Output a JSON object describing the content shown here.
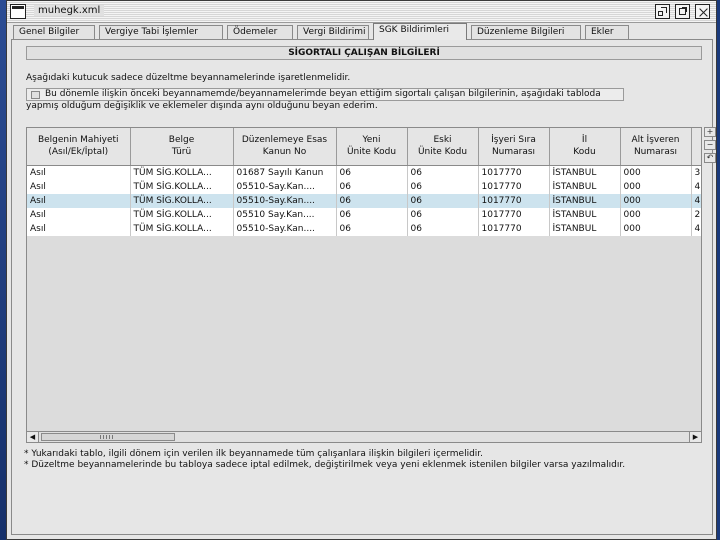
{
  "window": {
    "title": "muhegk.xml"
  },
  "tabs": [
    {
      "label": "Genel Bilgiler"
    },
    {
      "label": "Vergiye Tabi İşlemler"
    },
    {
      "label": "Ödemeler"
    },
    {
      "label": "Vergi Bildirimi"
    },
    {
      "label": "SGK Bildirimleri",
      "active": true
    },
    {
      "label": "Düzenleme Bilgileri"
    },
    {
      "label": "Ekler"
    }
  ],
  "section": {
    "title": "SİGORTALI ÇALIŞAN BİLGİLERİ",
    "instruction": "Aşağıdaki kutucuk sadece düzeltme beyannamelerinde işaretlenmelidir.",
    "checkbox_line1": "Bu dönemle ilişkin önceki beyannamemde/beyannamelerimde beyan ettiğim sigortalı çalışan bilgilerinin, aşağıdaki tabloda",
    "checkbox_line2": "yapmış olduğum değişiklik ve eklemeler dışında aynı olduğunu beyan ederim.",
    "checkbox_checked": false
  },
  "table": {
    "columns": [
      [
        "Belgenin Mahiyeti",
        "(Asıl/Ek/İptal)"
      ],
      [
        "Belge",
        "Türü"
      ],
      [
        "Düzenlemeye Esas",
        "Kanun No"
      ],
      [
        "Yeni",
        "Ünite Kodu"
      ],
      [
        "Eski",
        "Ünite Kodu"
      ],
      [
        "İşyeri Sıra",
        "Numarası"
      ],
      [
        "İl",
        "Kodu"
      ],
      [
        "Alt İşveren",
        "Numarası"
      ],
      [
        "",
        ""
      ]
    ],
    "rows": [
      [
        "Asıl",
        "TÜM SİG.KOLLA...",
        "01687 Sayılı Kanun",
        "06",
        "06",
        "1017770",
        "İSTANBUL",
        "000",
        "3"
      ],
      [
        "Asıl",
        "TÜM SİG.KOLLA...",
        "05510-Say.Kan....",
        "06",
        "06",
        "1017770",
        "İSTANBUL",
        "000",
        "4"
      ],
      [
        "Asıl",
        "TÜM SİG.KOLLA...",
        "05510-Say.Kan....",
        "06",
        "06",
        "1017770",
        "İSTANBUL",
        "000",
        "4"
      ],
      [
        "Asıl",
        "TÜM SİG.KOLLA...",
        "05510 Say.Kan....",
        "06",
        "06",
        "1017770",
        "İSTANBUL",
        "000",
        "2"
      ],
      [
        "Asıl",
        "TÜM SİG.KOLLA...",
        "05510-Say.Kan....",
        "06",
        "06",
        "1017770",
        "İSTANBUL",
        "000",
        "4"
      ]
    ],
    "selected_row": 2
  },
  "side_buttons": [
    "add-row-icon",
    "remove-row-icon",
    "undo-icon"
  ],
  "notes": [
    "* Yukarıdaki tablo, ilgili dönem için verilen ilk beyannamede tüm çalışanlara ilişkin bilgileri içermelidir.",
    "* Düzeltme beyannamelerinde bu tabloya sadece iptal edilmek, değiştirilmek veya yeni eklenmek istenilen bilgiler varsa yazılmalıdır."
  ]
}
